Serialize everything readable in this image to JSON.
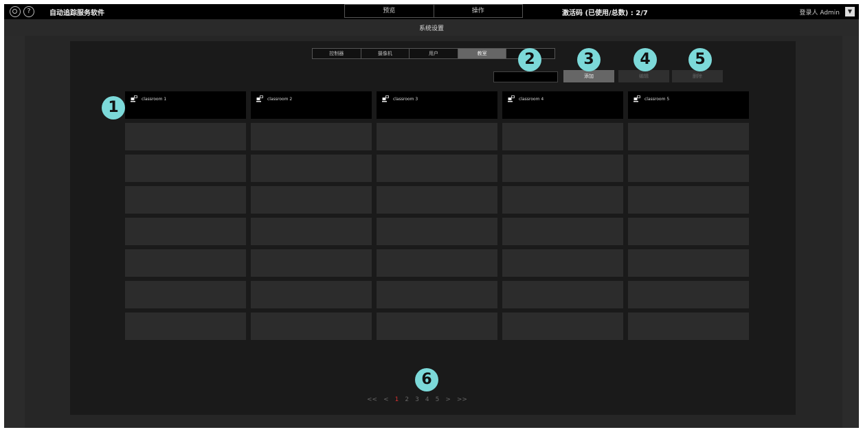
{
  "app": {
    "title": "自动追踪服务软件",
    "help_symbol": "?"
  },
  "top_tabs": [
    {
      "label": "预览"
    },
    {
      "label": "操作"
    }
  ],
  "activation": "激活码 (已使用/总数) : 2/7",
  "login": {
    "label": "登录人 Admin",
    "dropdown_symbol": "▼"
  },
  "page_title": "系统设置",
  "sub_tabs": [
    {
      "label": "控制器"
    },
    {
      "label": "摄像机"
    },
    {
      "label": "用户"
    },
    {
      "label": "教室",
      "active": true
    },
    {
      "label": ""
    }
  ],
  "search": {
    "value": ""
  },
  "actions": {
    "add": "添加",
    "edit": "编辑",
    "delete": "删除"
  },
  "classrooms": [
    {
      "name": "classroom 1"
    },
    {
      "name": "classroom 2"
    },
    {
      "name": "classroom 3"
    },
    {
      "name": "classroom 4"
    },
    {
      "name": "classroom 5"
    }
  ],
  "grid": {
    "columns": 5,
    "rows": 8
  },
  "pagination": {
    "first": "<<",
    "prev": "<",
    "pages": [
      "1",
      "2",
      "3",
      "4",
      "5"
    ],
    "current": "1",
    "next": ">",
    "last": ">>"
  },
  "callouts": [
    "1",
    "2",
    "3",
    "4",
    "5",
    "6"
  ],
  "colors": {
    "background": "#222222",
    "topbar": "#000000",
    "callout": "#7cd9d9",
    "current_page": "#d93030"
  },
  "icons": {
    "settings": "gear-icon",
    "help": "help-icon",
    "classroom": "classroom-camera-icon",
    "dropdown": "chevron-down-icon"
  }
}
